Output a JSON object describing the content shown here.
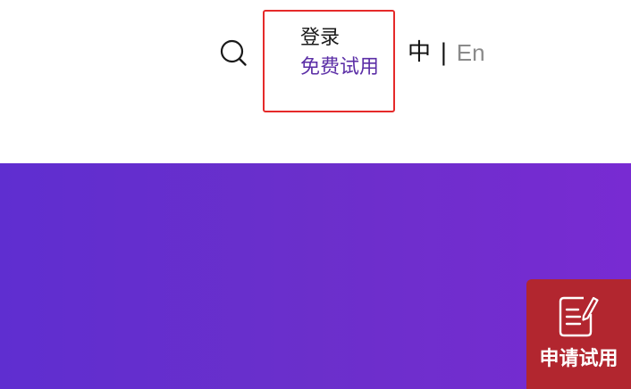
{
  "header": {
    "search_icon": "search-icon",
    "login_label": "登录",
    "trial_label": "免费试用",
    "lang_zh": "中",
    "lang_separator": "|",
    "lang_en": "En",
    "highlight_color": "#e52a2a",
    "trial_color": "#5b2ea6",
    "lang_inactive_color": "#8a8a8a"
  },
  "hero": {
    "gradient_start": "#5f2ed0",
    "gradient_end": "#782bd2"
  },
  "floating_button": {
    "icon": "edit-document-icon",
    "label": "申请试用",
    "background": "#b2262f"
  }
}
